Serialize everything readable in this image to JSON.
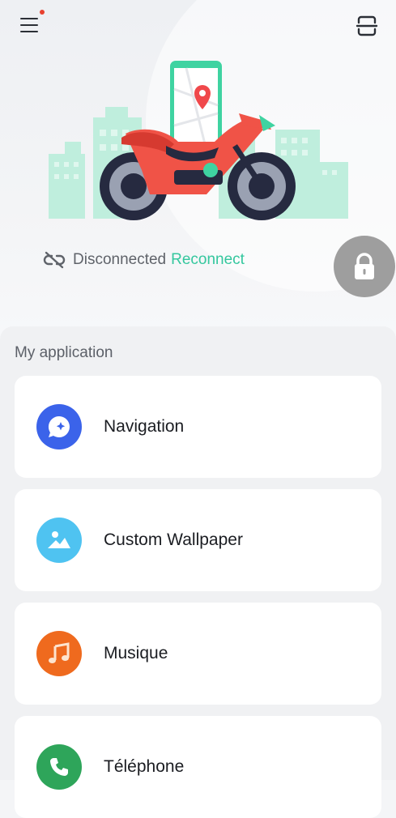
{
  "header": {
    "menu_icon": "hamburger-menu-icon",
    "scan_icon": "scan-icon"
  },
  "connection": {
    "status": "Disconnected",
    "action": "Reconnect",
    "status_color": "#5f636a",
    "action_color": "#34c79e"
  },
  "section": {
    "title": "My application"
  },
  "apps": [
    {
      "label": "Navigation",
      "icon": "navigation-icon",
      "color": "#3b63ea"
    },
    {
      "label": "Custom Wallpaper",
      "icon": "wallpaper-icon",
      "color": "#4fc3f1"
    },
    {
      "label": "Musique",
      "icon": "music-icon",
      "color": "#ef6a1e"
    },
    {
      "label": "Téléphone",
      "icon": "phone-icon",
      "color": "#2ea55a"
    }
  ]
}
